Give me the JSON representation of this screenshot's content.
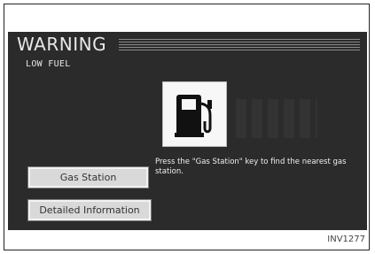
{
  "warning": {
    "title": "WARNING",
    "subtitle": "LOW FUEL"
  },
  "icon": {
    "name": "fuel-pump-icon"
  },
  "buttons": {
    "gas_station": "Gas Station",
    "detailed_information": "Detailed Information"
  },
  "message": "Press the \"Gas Station\" key to find the nearest gas station.",
  "figure_code": "INV1277",
  "colors": {
    "screen_bg": "#2b2b2b",
    "text": "#e8e8e8",
    "button_bg": "#d9d9d9"
  }
}
